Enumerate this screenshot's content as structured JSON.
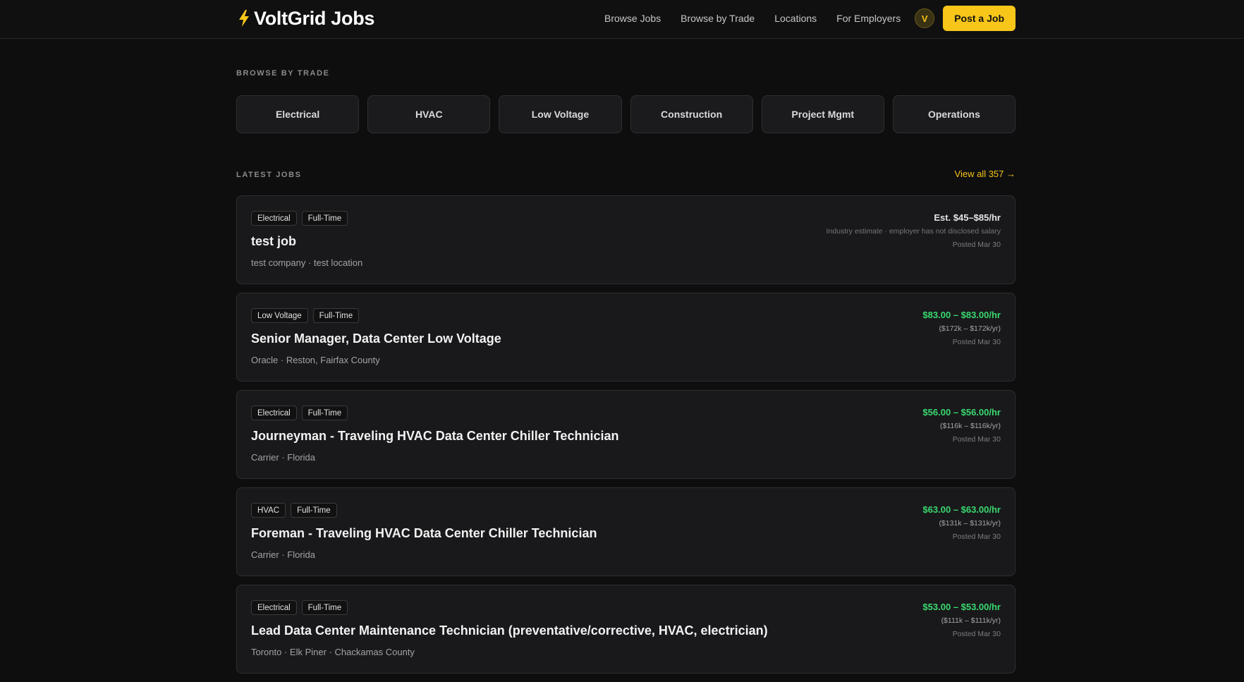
{
  "header": {
    "logo_text": "VoltGrid Jobs",
    "nav": [
      "Browse Jobs",
      "Browse by Trade",
      "Locations",
      "For Employers"
    ],
    "avatar_initial": "V",
    "post_job_label": "Post a Job"
  },
  "trades_section": {
    "label": "BROWSE BY TRADE",
    "trades": [
      "Electrical",
      "HVAC",
      "Low Voltage",
      "Construction",
      "Project Mgmt",
      "Operations"
    ]
  },
  "jobs_section": {
    "label": "LATEST JOBS",
    "view_all": "View all 357 →",
    "jobs": [
      {
        "tags": [
          "Electrical",
          "Full-Time"
        ],
        "title": "test job",
        "meta": "test company · test location",
        "pay": "Est. $45–$85/hr",
        "pay_sub": "Industry estimate · employer has not disclosed salary",
        "posted": "Posted Mar 30"
      },
      {
        "tags": [
          "Low Voltage",
          "Full-Time"
        ],
        "title": "Senior Manager, Data Center Low Voltage",
        "meta": "Oracle · Reston, Fairfax County",
        "pay": "$83.00 – $83.00/hr",
        "pay_sub": "($172k – $172k/yr)",
        "posted": "Posted Mar 30"
      },
      {
        "tags": [
          "Electrical",
          "Full-Time"
        ],
        "title": "Journeyman - Traveling HVAC Data Center Chiller Technician",
        "meta": "Carrier · Florida",
        "pay": "$56.00 – $56.00/hr",
        "pay_sub": "($116k – $116k/yr)",
        "posted": "Posted Mar 30"
      },
      {
        "tags": [
          "HVAC",
          "Full-Time"
        ],
        "title": "Foreman - Traveling HVAC Data Center Chiller Technician",
        "meta": "Carrier · Florida",
        "pay": "$63.00 – $63.00/hr",
        "pay_sub": "($131k – $131k/yr)",
        "posted": "Posted Mar 30"
      },
      {
        "tags": [
          "Electrical",
          "Full-Time"
        ],
        "title": "Lead Data Center Maintenance Technician (preventative/corrective, HVAC, electrician)",
        "meta": "Toronto · Elk Piner · Chackamas County",
        "pay": "$53.00 – $53.00/hr",
        "pay_sub": "($111k – $111k/yr)",
        "posted": "Posted Mar 30"
      }
    ]
  },
  "colors": {
    "background": "#0e0e0f",
    "accent": "#f8c619",
    "pay_green": "#39d86f",
    "card": "#19191b"
  }
}
